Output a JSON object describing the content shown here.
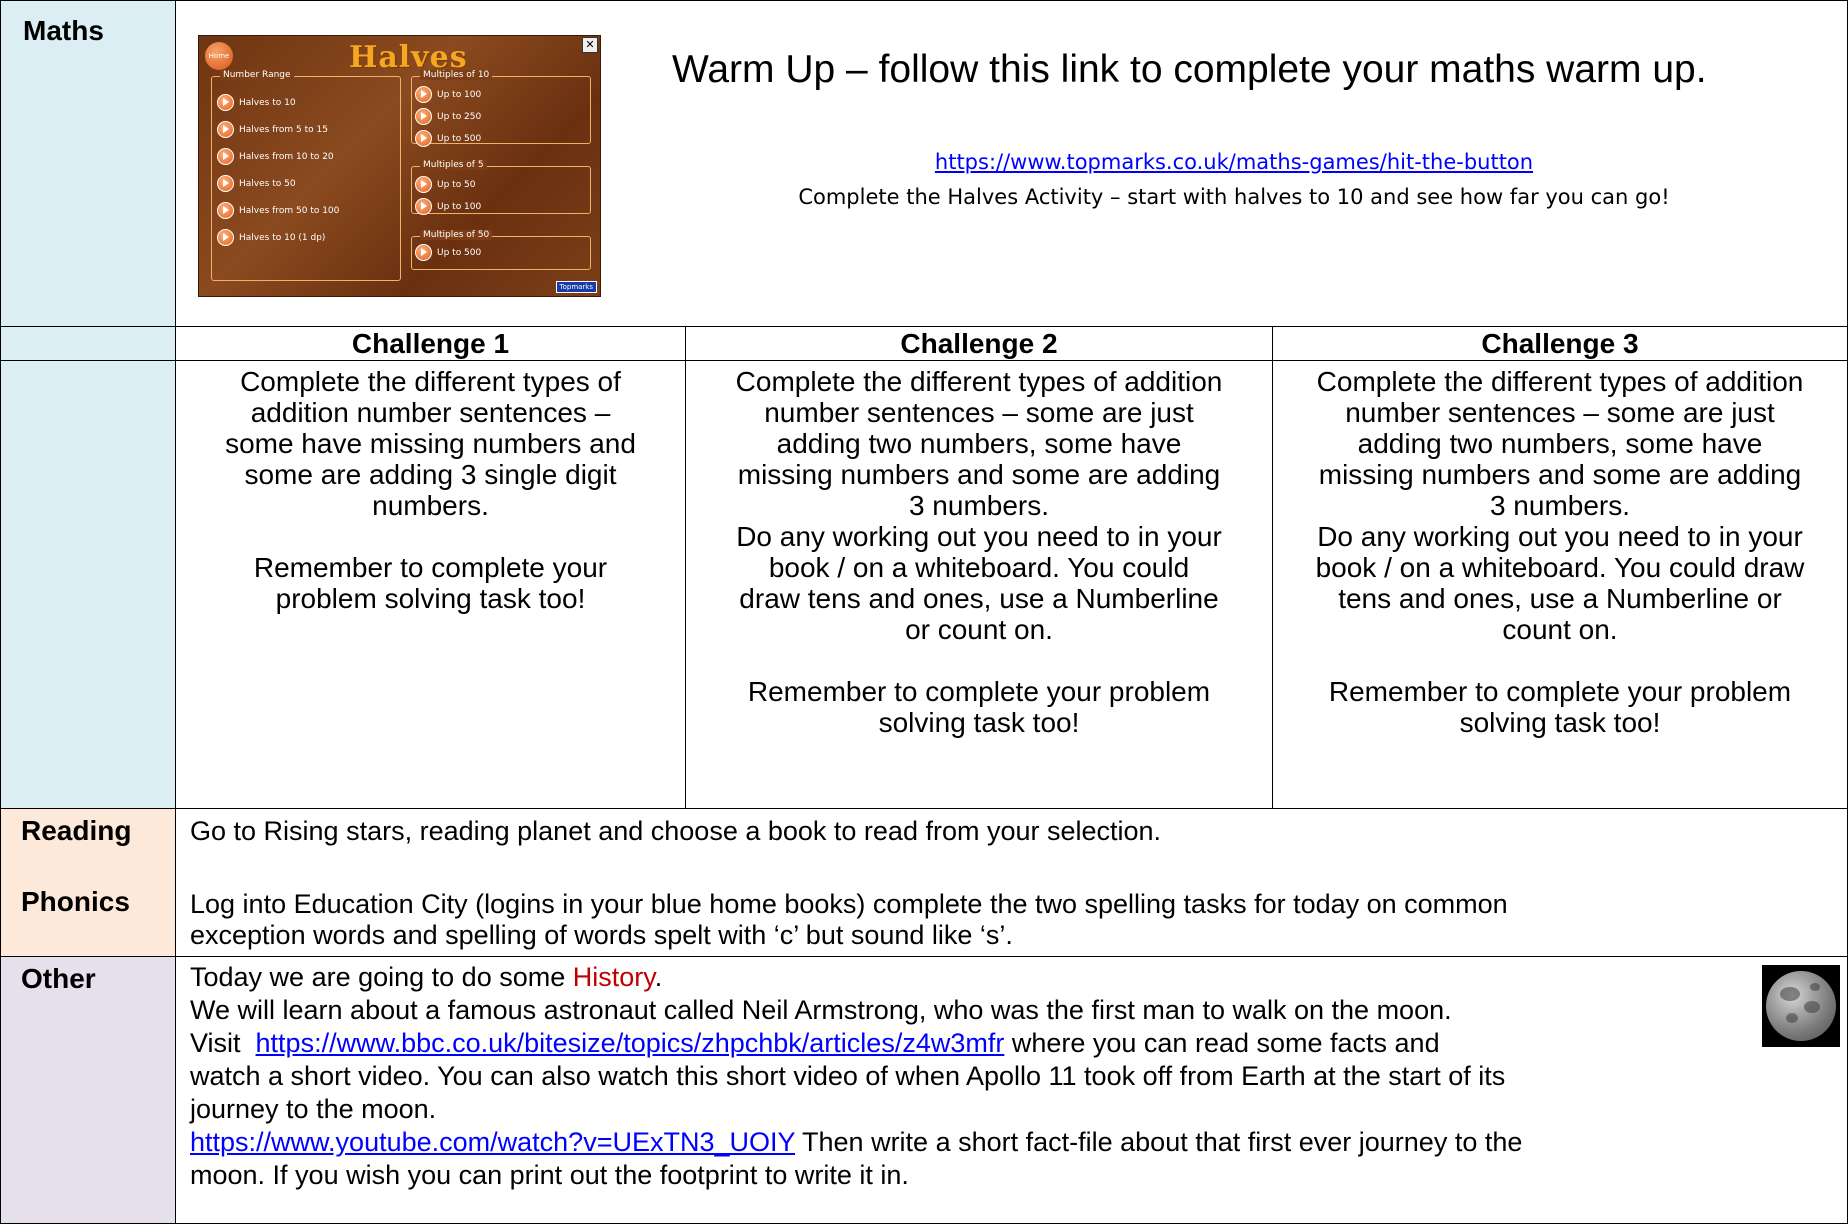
{
  "maths": {
    "label": "Maths",
    "warmup_title": "Warm Up – follow this link to complete your maths warm up.",
    "warmup_link": "https://www.topmarks.co.uk/maths-games/hit-the-button",
    "warmup_instruction": "Complete the Halves Activity – start with halves to 10 and see how far you can go!",
    "game": {
      "home_label": "Home",
      "title": "Halves",
      "close_label": "✕",
      "brand_label": "Topmarks",
      "number_range": {
        "title": "Number Range",
        "items": [
          "Halves to 10",
          "Halves from 5 to 15",
          "Halves from 10 to 20",
          "Halves to 50",
          "Halves from 50 to 100",
          "Halves to 10 (1 dp)"
        ]
      },
      "multiples_10": {
        "title": "Multiples of 10",
        "items": [
          "Up to 100",
          "Up to 250",
          "Up to 500"
        ]
      },
      "multiples_5": {
        "title": "Multiples of 5",
        "items": [
          "Up to 50",
          "Up to 100"
        ]
      },
      "multiples_50": {
        "title": "Multiples of 50",
        "items": [
          "Up to 500"
        ]
      }
    },
    "challenges": [
      {
        "header": "Challenge 1",
        "lines": [
          "Complete the different types of",
          "addition number sentences –",
          "some have missing numbers and",
          "some are adding 3 single digit",
          "numbers.",
          "",
          "Remember to complete your",
          "problem solving task too!"
        ]
      },
      {
        "header": "Challenge 2",
        "lines": [
          "Complete the different types of addition",
          "number sentences – some are just",
          "adding two numbers, some have",
          "missing numbers and some are adding",
          "3 numbers.",
          "Do any working out you need to in your",
          "book / on a whiteboard. You could",
          "draw tens and ones, use a Numberline",
          "or count on.",
          "",
          "Remember to complete your problem",
          "solving task too!"
        ]
      },
      {
        "header": "Challenge 3",
        "lines": [
          "Complete the different types of addition",
          "number sentences – some are just",
          "adding two numbers, some have",
          "missing numbers and some are adding",
          "3 numbers.",
          "Do any working out you need to in your",
          "book / on a whiteboard. You could draw",
          "tens and ones, use a Numberline or",
          "count on.",
          "",
          "Remember to complete your problem",
          "solving task too!"
        ]
      }
    ]
  },
  "reading": {
    "label": "Reading",
    "text": "Go to Rising stars, reading planet and choose a book to read from your selection."
  },
  "phonics": {
    "label": "Phonics",
    "line1": "Log into Education City (logins in your blue home books) complete the two spelling tasks for today on common",
    "line2": "exception words and spelling of words spelt with ‘c’ but sound like ‘s’."
  },
  "other": {
    "label": "Other",
    "intro": "Today we are going to do some ",
    "history": "History",
    "intro_end": ".",
    "line2": "We will learn about a famous astronaut called Neil Armstrong, who was the first man to walk on the moon.",
    "visit": "Visit  ",
    "bbc_link": "https://www.bbc.co.uk/bitesize/topics/zhpchbk/articles/z4w3mfr",
    "after_bbc": " where you can read some facts and",
    "line4": "watch a short video.  You can also watch this short video of when Apollo 11 took off from Earth at the start of its",
    "line5": "journey to the moon.",
    "yt_link": "https://www.youtube.com/watch?v=UExTN3_UOIY",
    "after_yt": " Then write a short fact-file about that first ever journey to the",
    "line7": "moon.  If you wish you can print out the footprint to write it in."
  }
}
